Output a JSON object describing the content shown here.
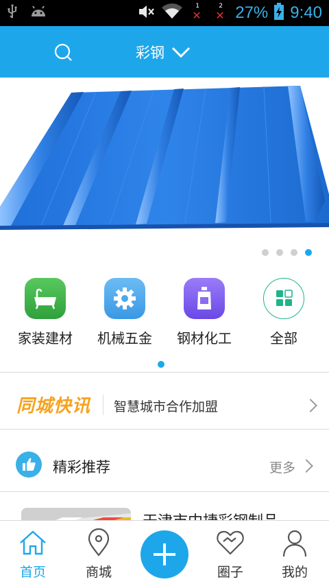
{
  "status_bar": {
    "left_icons": [
      "usb-icon",
      "android-icon"
    ],
    "right_icons": [
      "mute-icon",
      "wifi-icon",
      "sim1-no-signal-icon",
      "sim2-no-signal-icon",
      "battery-charging-icon"
    ],
    "sim1_label": "1",
    "sim2_label": "2",
    "sim_error_mark": "✕",
    "battery": "27%",
    "time": "9:40",
    "color": "#3ab0e8"
  },
  "header": {
    "search_icon": "search-icon",
    "category_select": "彩钢",
    "dropdown_icon": "chevron-down-icon",
    "background": "#1da7ea"
  },
  "banner": {
    "image": "blue-corrugated-steel-roof-panel",
    "slides": 4,
    "active_slide": 4
  },
  "categories": [
    {
      "label": "家装建材",
      "icon": "bathtub-icon",
      "color": "#3cb54a"
    },
    {
      "label": "机械五金",
      "icon": "gear-icon",
      "color": "#4aa8ec"
    },
    {
      "label": "钢材化工",
      "icon": "chemical-bottle-icon",
      "color": "#7a5af0"
    },
    {
      "label": "全部",
      "icon": "grid-all-icon",
      "color": "#1fb48a"
    }
  ],
  "categories_page": {
    "pages": 1,
    "active": 1
  },
  "news": {
    "logo": "同城快讯",
    "text": "智慧城市合作加盟",
    "logo_color": "#f6a21e"
  },
  "recommend": {
    "icon": "thumbs-up-icon",
    "title": "精彩推荐",
    "more": "更多"
  },
  "list": [
    {
      "title": "天津市中捷彩钢制品",
      "thumb": "colored-steel-sheets-thumbnail"
    }
  ],
  "bottom_nav": {
    "items": [
      {
        "label": "首页",
        "icon": "home-icon",
        "active": true
      },
      {
        "label": "商城",
        "icon": "location-pin-icon",
        "active": false
      },
      {
        "label": "",
        "icon": "plus-icon",
        "active": false
      },
      {
        "label": "圈子",
        "icon": "heart-handshake-icon",
        "active": false
      },
      {
        "label": "我的",
        "icon": "user-icon",
        "active": false
      }
    ],
    "active_color": "#1da7ea"
  }
}
